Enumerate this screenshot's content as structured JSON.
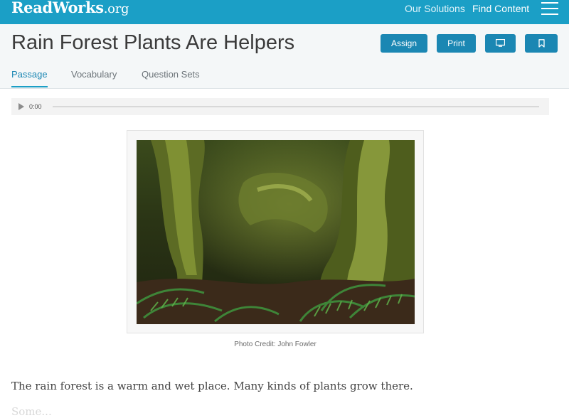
{
  "topbar": {
    "logo_main": "ReadWorks",
    "logo_suffix": ".org",
    "nav": [
      "Our Solutions",
      "Find Content"
    ],
    "menu_icon": "hamburger-menu-icon"
  },
  "header": {
    "title": "Rain Forest Plants Are Helpers",
    "buttons": {
      "assign": "Assign",
      "print": "Print",
      "present_icon": "monitor-icon",
      "bookmark_icon": "bookmark-icon"
    },
    "tabs": [
      "Passage",
      "Vocabulary",
      "Question Sets"
    ],
    "active_tab": "Passage"
  },
  "audio": {
    "time": "0:00",
    "play_icon": "play-icon"
  },
  "figure": {
    "credit": "Photo Credit: John Fowler"
  },
  "passage": {
    "first_line": "The rain forest is a warm and wet place. Many kinds of plants grow there.",
    "faded_line": "Some..."
  },
  "colors": {
    "topbar": "#1b9fc6",
    "button": "#1b87b3",
    "header_bg": "#f4f7f8"
  }
}
